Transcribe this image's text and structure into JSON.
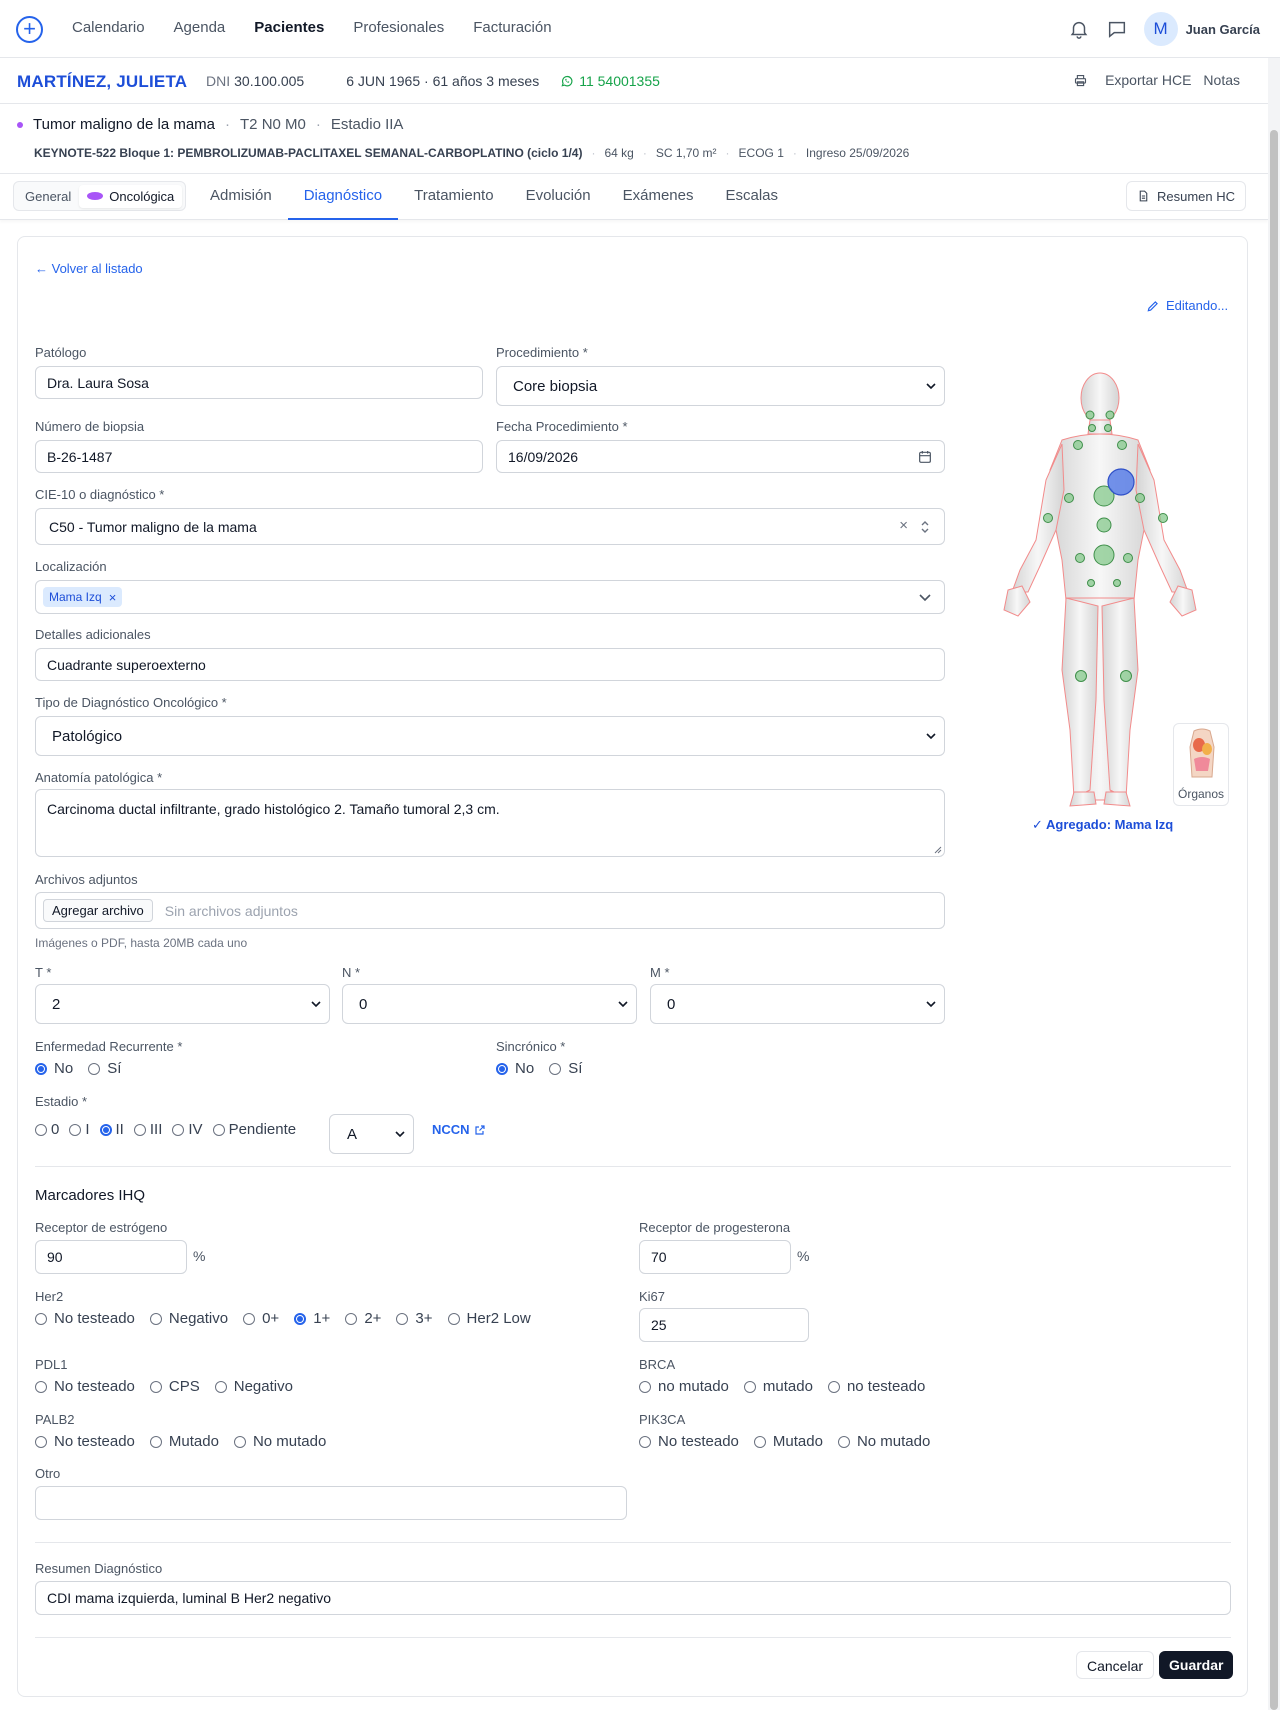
{
  "nav": {
    "links": [
      "Calendario",
      "Agenda",
      "Pacientes",
      "Profesionales",
      "Facturación"
    ],
    "active": "Pacientes",
    "avatar_initial": "M",
    "user_name": "Juan García"
  },
  "patient": {
    "name": "MARTÍNEZ, JULIETA",
    "dni_label": "DNI",
    "dni": "30.100.005",
    "birth": "6 JUN 1965 · 61 años 3 meses",
    "phone": "11 54001355",
    "export_label": "Exportar HCE",
    "notes_label": "Notas"
  },
  "diagnosis_header": {
    "title": "Tumor maligno de la mama",
    "tnm": "T2 N0 M0",
    "stage": "Estadio IIA",
    "regimen": "KEYNOTE-522 Bloque 1: PEMBROLIZUMAB-PACLITAXEL SEMANAL-CARBOPLATINO (ciclo 1/4)",
    "weight": "64 kg",
    "sc": "SC 1,70 m²",
    "ecog": "ECOG 1",
    "admission": "Ingreso 25/09/2026"
  },
  "tabs": {
    "seg_general": "General",
    "seg_onco": "Oncológica",
    "items": [
      "Admisión",
      "Diagnóstico",
      "Tratamiento",
      "Evolución",
      "Exámenes",
      "Escalas"
    ],
    "active": "Diagnóstico",
    "resumen_label": "Resumen HC"
  },
  "form": {
    "back_label": "← Volver al listado",
    "editing_label": "Editando...",
    "patologo": {
      "label": "Patólogo",
      "value": "Dra. Laura Sosa"
    },
    "procedimiento": {
      "label": "Procedimiento *",
      "value": "Core biopsia"
    },
    "biopsia": {
      "label": "Número de biopsia",
      "value": "B-26-1487"
    },
    "fecha": {
      "label": "Fecha Procedimiento *",
      "value": "16/09/2026"
    },
    "cie": {
      "label": "CIE-10 o diagnóstico *",
      "value": "C50 - Tumor maligno de la mama"
    },
    "localizacion": {
      "label": "Localización",
      "tag": "Mama Izq"
    },
    "detalles": {
      "label": "Detalles adicionales",
      "value": "Cuadrante superoexterno"
    },
    "tipo": {
      "label": "Tipo de Diagnóstico Oncológico *",
      "value": "Patológico"
    },
    "anatomia": {
      "label": "Anatomía patológica *",
      "value": "Carcinoma ductal infiltrante, grado histológico 2. Tamaño tumoral 2,3 cm."
    },
    "archivos": {
      "label": "Archivos adjuntos",
      "button": "Agregar archivo",
      "placeholder": "Sin archivos adjuntos",
      "hint": "Imágenes o PDF, hasta 20MB cada uno"
    },
    "t": {
      "label": "T *",
      "value": "2"
    },
    "n": {
      "label": "N *",
      "value": "0"
    },
    "m": {
      "label": "M *",
      "value": "0"
    },
    "recurrente": {
      "label": "Enfermedad Recurrente *",
      "options": [
        "No",
        "Sí"
      ],
      "selected": "No"
    },
    "sincronico": {
      "label": "Sincrónico *",
      "options": [
        "No",
        "Sí"
      ],
      "selected": "No"
    },
    "estadio": {
      "label": "Estadio *",
      "options": [
        "0",
        "I",
        "II",
        "III",
        "IV",
        "Pendiente"
      ],
      "selected": "II",
      "sub_value": "A",
      "nccn_label": "NCCN"
    },
    "body_map": {
      "added_label": "✓ Agregado: Mama Izq",
      "organs_label": "Órganos"
    }
  },
  "ihq": {
    "title": "Marcadores IHQ",
    "re": {
      "label": "Receptor de estrógeno",
      "value": "90",
      "unit": "%"
    },
    "rp": {
      "label": "Receptor de progesterona",
      "value": "70",
      "unit": "%"
    },
    "her2": {
      "label": "Her2",
      "options": [
        "No testeado",
        "Negativo",
        "0+",
        "1+",
        "2+",
        "3+",
        "Her2 Low"
      ],
      "selected": "1+"
    },
    "ki67": {
      "label": "Ki67",
      "value": "25"
    },
    "pdl1": {
      "label": "PDL1",
      "options": [
        "No testeado",
        "CPS",
        "Negativo"
      ]
    },
    "brca": {
      "label": "BRCA",
      "options": [
        "no mutado",
        "mutado",
        "no testeado"
      ]
    },
    "palb2": {
      "label": "PALB2",
      "options": [
        "No testeado",
        "Mutado",
        "No mutado"
      ]
    },
    "pik3ca": {
      "label": "PIK3CA",
      "options": [
        "No testeado",
        "Mutado",
        "No mutado"
      ]
    },
    "otro": {
      "label": "Otro",
      "value": ""
    }
  },
  "summary": {
    "label": "Resumen Diagnóstico",
    "value": "CDI mama izquierda, luminal B Her2 negativo"
  },
  "actions": {
    "cancel": "Cancelar",
    "save": "Guardar"
  },
  "colors": {
    "accent": "#2563eb",
    "whatsapp": "#16a34a",
    "onco_dot": "#a855f7",
    "save_bg": "#111827"
  }
}
